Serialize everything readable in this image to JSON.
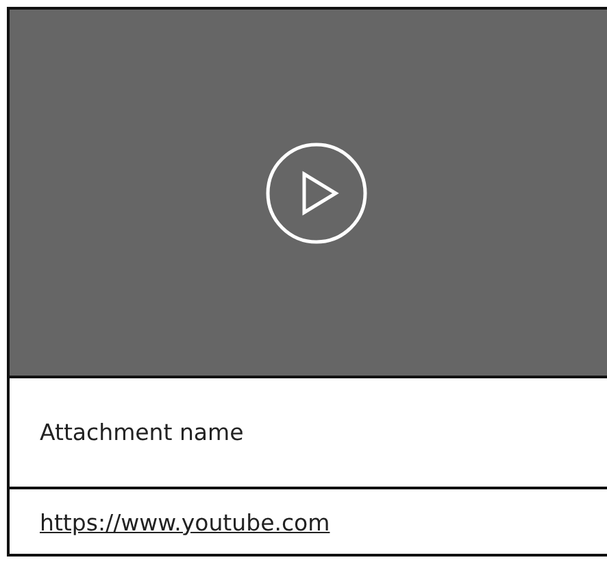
{
  "attachment": {
    "preview": {
      "kind": "video"
    },
    "name": "Attachment name",
    "link": "https://www.youtube.com"
  }
}
